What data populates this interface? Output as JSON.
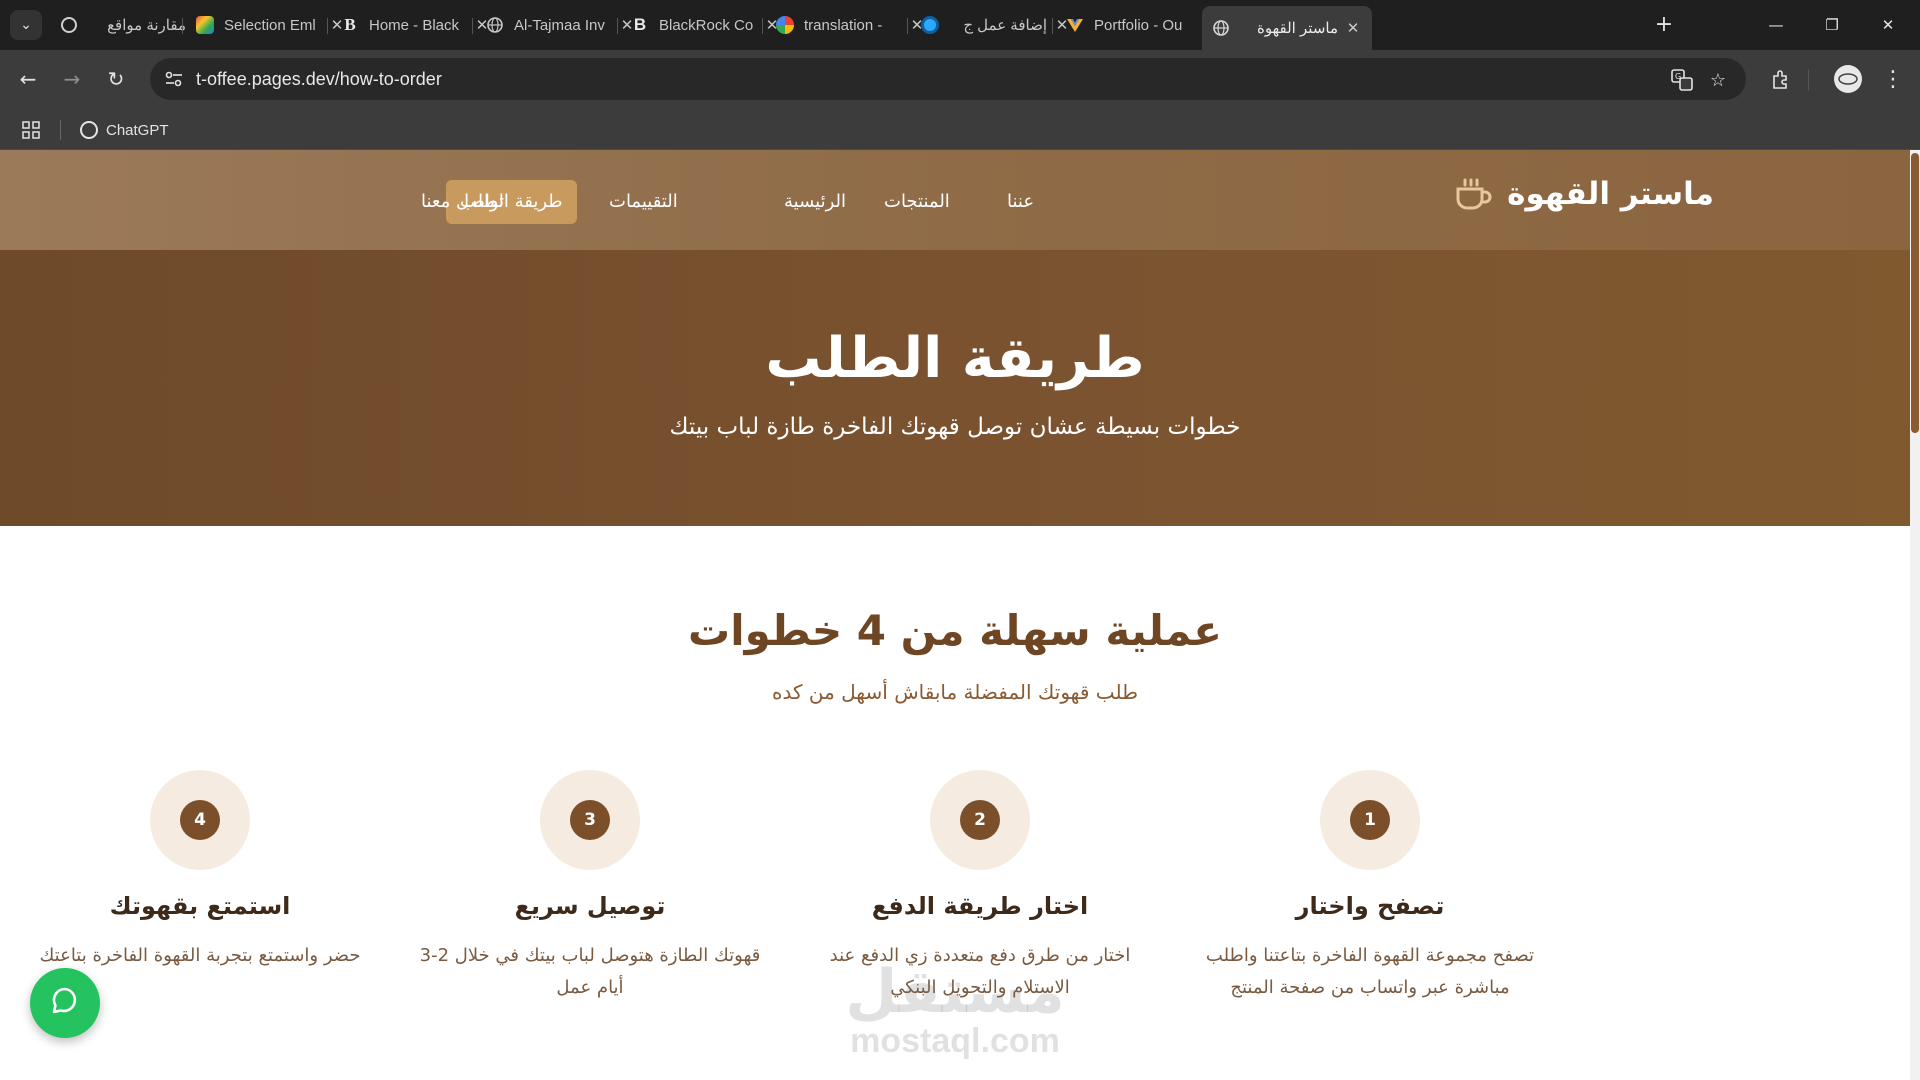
{
  "browser": {
    "tabs": [
      {
        "label": "مقارنة مواقع",
        "favicon": "chatgpt-icon",
        "active": false
      },
      {
        "label": "Selection Eml",
        "favicon": "multicolor-app-icon",
        "active": false
      },
      {
        "label": "Home - Black",
        "favicon": "letter-b-icon",
        "active": false
      },
      {
        "label": "Al-Tajmaa Inv",
        "favicon": "globe-icon",
        "active": false
      },
      {
        "label": "BlackRock Co",
        "favicon": "letter-b-icon",
        "active": false
      },
      {
        "label": "translation -",
        "favicon": "google-icon",
        "active": false
      },
      {
        "label": "إضافة عمل ج",
        "favicon": "blue-circle-icon",
        "active": false
      },
      {
        "label": "Portfolio - Ou",
        "favicon": "vue-icon",
        "active": false
      },
      {
        "label": "ماستر القهوة",
        "favicon": "globe-icon",
        "active": true
      }
    ],
    "address": "t-offee.pages.dev/how-to-order",
    "bookmarks": [
      {
        "label": "ChatGPT"
      }
    ]
  },
  "site": {
    "brand": "ماستر القهوة",
    "nav": [
      {
        "label": "الرئيسية",
        "active": false
      },
      {
        "label": "المنتجات",
        "active": false
      },
      {
        "label": "عننا",
        "active": false
      },
      {
        "label": "طريقة الطلب",
        "active": true
      },
      {
        "label": "التقييمات",
        "active": false
      },
      {
        "label": "تواصل معنا",
        "active": false
      }
    ],
    "hero": {
      "title": "طريقة الطلب",
      "subtitle": "خطوات بسيطة عشان توصل قهوتك الفاخرة طازة لباب بيتك"
    },
    "steps_section": {
      "title": "عملية سهلة من 4 خطوات",
      "subtitle": "طلب قهوتك المفضلة مابقاش أسهل من كده",
      "steps": [
        {
          "number": "1",
          "title": "تصفح واختار",
          "description": "تصفح مجموعة القهوة الفاخرة بتاعتنا واطلب مباشرة عبر واتساب من صفحة المنتج"
        },
        {
          "number": "2",
          "title": "اختار طريقة الدفع",
          "description": "اختار من طرق دفع متعددة زي الدفع عند الاستلام والتحويل البنكي"
        },
        {
          "number": "3",
          "title": "توصيل سريع",
          "description": "قهوتك الطازة هتوصل لباب بيتك في خلال 2-3 أيام عمل"
        },
        {
          "number": "4",
          "title": "استمتع بقهوتك",
          "description": "حضر واستمتع بتجربة القهوة الفاخرة بتاعتك"
        }
      ]
    },
    "watermark": {
      "arabic": "مستقل",
      "latin": "mostaql.com"
    }
  },
  "colors": {
    "header": "#9b7a5a",
    "hero": "#7a5230",
    "nav_active": "#c99a5e",
    "accent_brown": "#7a4f2a",
    "step_circle": "#f5ebe0",
    "chat_button": "#25c360"
  }
}
